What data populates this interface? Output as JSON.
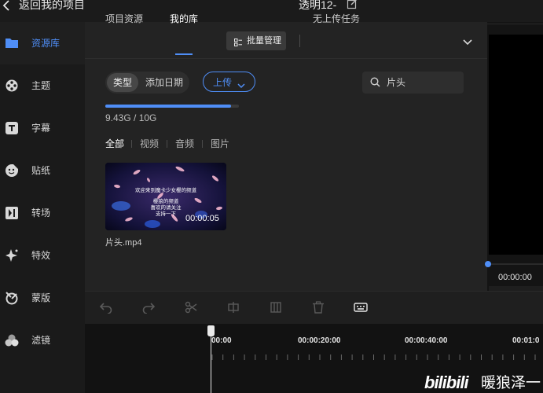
{
  "topbar": {
    "back_label": "返回我的项目",
    "project_title": "透明12-"
  },
  "sidebar": {
    "items": [
      {
        "label": "资源库",
        "icon": "folder-icon"
      },
      {
        "label": "主题",
        "icon": "film-reel-icon"
      },
      {
        "label": "字幕",
        "icon": "text-t-icon"
      },
      {
        "label": "贴纸",
        "icon": "sticker-smile-icon"
      },
      {
        "label": "转场",
        "icon": "transition-icon"
      },
      {
        "label": "特效",
        "icon": "sparkle-icon"
      },
      {
        "label": "蒙版",
        "icon": "mask-icon"
      },
      {
        "label": "滤镜",
        "icon": "filter-circles-icon"
      }
    ],
    "active_index": 0
  },
  "tabs": {
    "project_assets": "项目资源",
    "my_library": "我的库",
    "batch_manage": "批量管理",
    "no_upload_tasks": "无上传任务"
  },
  "filters": {
    "type": "类型",
    "date_added": "添加日期",
    "upload": "上传",
    "search_value": "片头"
  },
  "storage": {
    "text": "9.43G / 10G",
    "used_fraction": 0.943
  },
  "media_types": [
    "全部",
    "视频",
    "音频",
    "图片"
  ],
  "media_items": [
    {
      "name": "片头.mp4",
      "duration": "00:00:05",
      "overlay_lines": [
        "欢迎来到魔卡少女樱的频道",
        "樱狼的频道",
        "喜欢的请关注",
        "支持一下"
      ]
    }
  ],
  "preview": {
    "timecode": "00:00:00"
  },
  "toolbar": {
    "icons": [
      "undo-icon",
      "redo-icon",
      "split-icon",
      "crop-icon",
      "freeze-icon",
      "delete-icon",
      "subtitle-icon"
    ]
  },
  "timeline": {
    "labels": [
      "00:00",
      "00:00:20:00",
      "00:00:40:00",
      "00:01:0"
    ]
  },
  "watermark": {
    "logo": "bilibili",
    "author": "暖狼泽一"
  },
  "colors": {
    "accent": "#4f8ef7",
    "background": "#141414",
    "panel": "#232323"
  }
}
